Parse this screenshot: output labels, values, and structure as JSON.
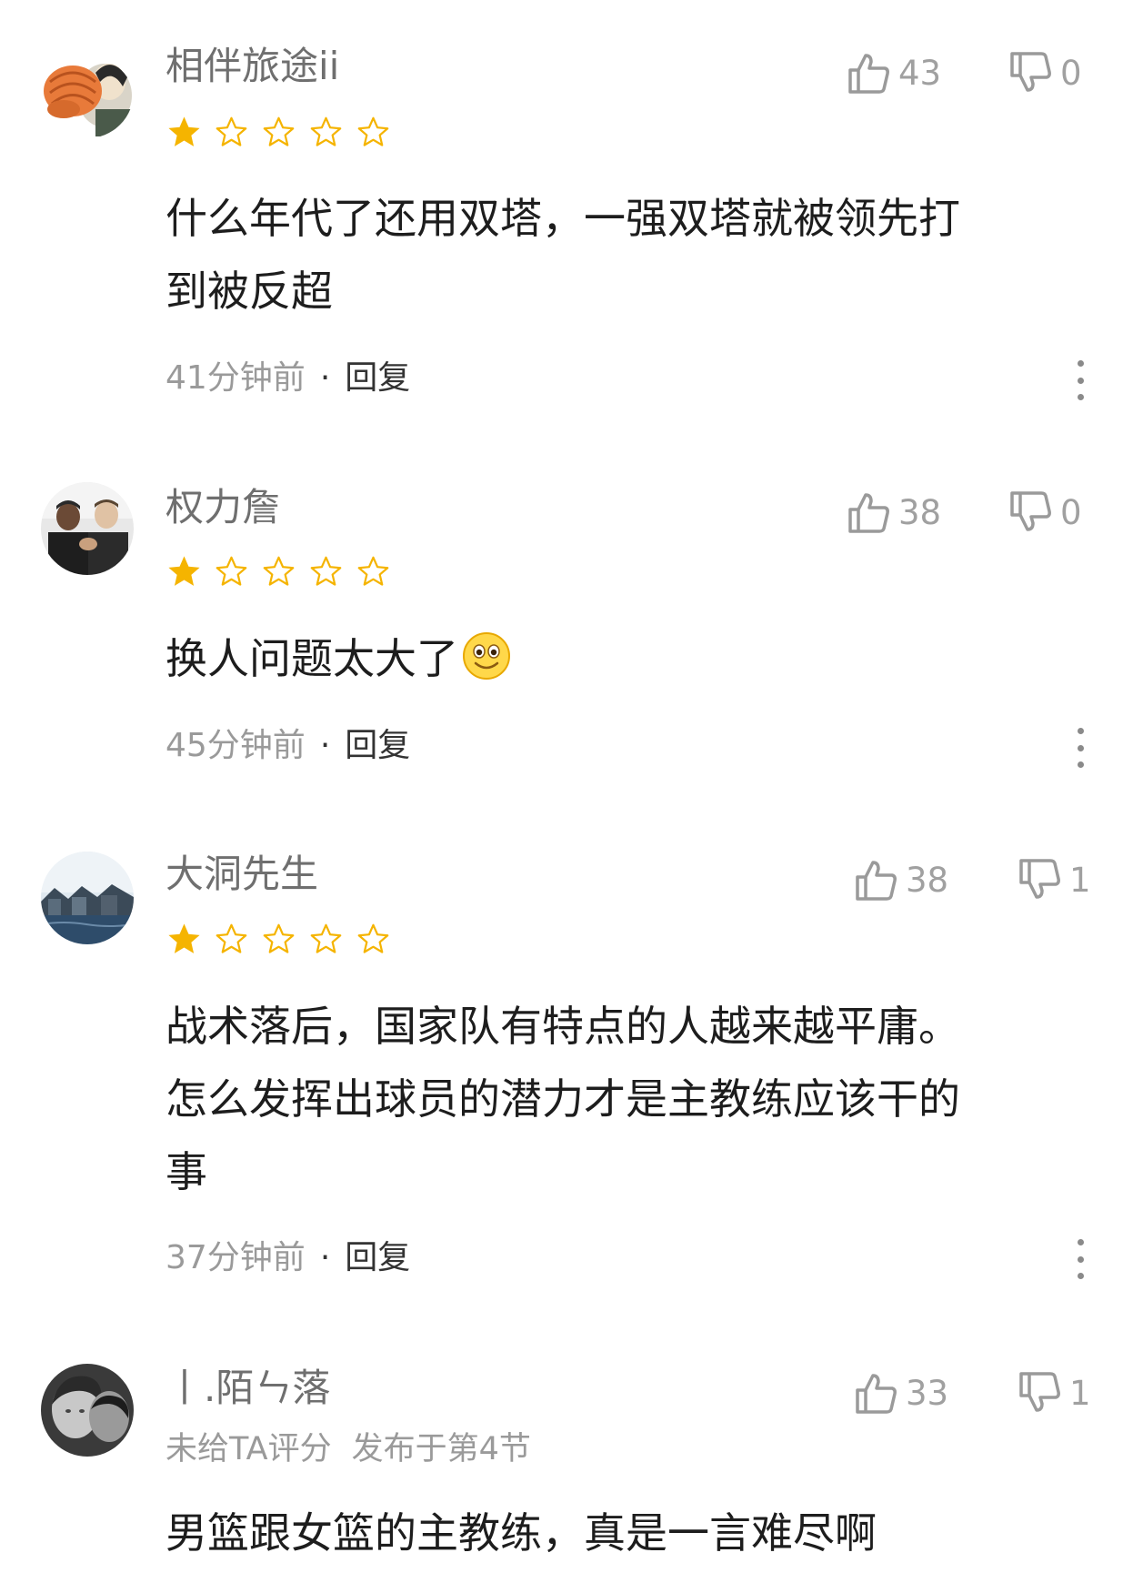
{
  "comments": [
    {
      "username": "相伴旅途ii",
      "rating": 1,
      "likes": "43",
      "dislikes": "0",
      "lines": [
        "什么年代了还用双塔，一强双塔就被领先打",
        "到被反超"
      ],
      "time": "41分钟前",
      "dot": "·",
      "reply": "回复"
    },
    {
      "username": "权力詹",
      "rating": 1,
      "likes": "38",
      "dislikes": "0",
      "lines": [
        "换人问题太大了"
      ],
      "emoji": "smile-emoji",
      "time": "45分钟前",
      "dot": "·",
      "reply": "回复"
    },
    {
      "username": "大洞先生",
      "rating": 1,
      "likes": "38",
      "dislikes": "1",
      "lines": [
        "战术落后，国家队有特点的人越来越平庸。",
        "怎么发挥出球员的潜力才是主教练应该干的",
        "事"
      ],
      "time": "37分钟前",
      "dot": "·",
      "reply": "回复"
    },
    {
      "username": "丨.陌ㄣ落",
      "rating_text": "未给TA评分",
      "published": "发布于第4节",
      "likes": "33",
      "dislikes": "1",
      "lines": [
        "男篮跟女篮的主教练，真是一言难尽啊"
      ]
    }
  ],
  "colors": {
    "star_filled": "#f5b400",
    "star_empty": "#f5b400",
    "muted_text": "#9a9a9a",
    "username": "#6f6f6f"
  },
  "icons": [
    "thumbs-up-icon",
    "thumbs-down-icon",
    "star-filled-icon",
    "star-outline-icon",
    "more-vertical-icon"
  ]
}
